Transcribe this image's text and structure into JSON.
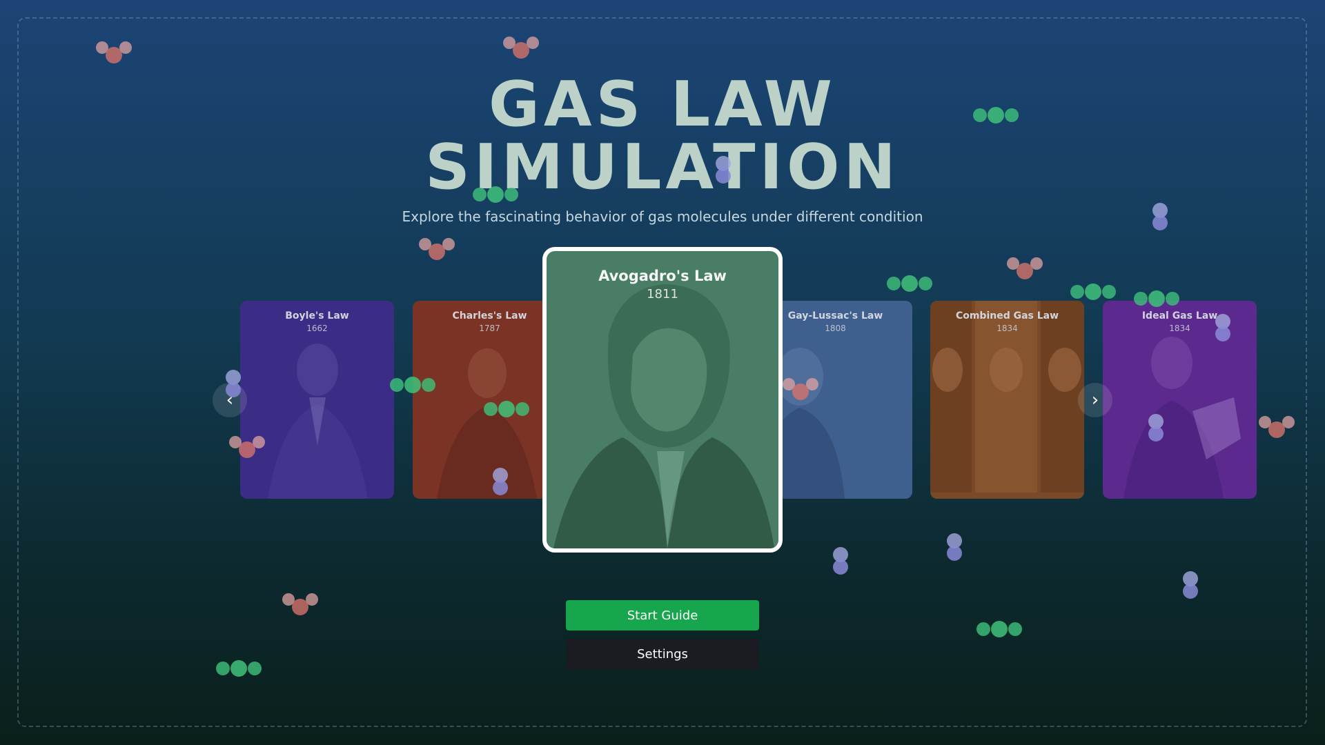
{
  "title": {
    "line1": "GAS LAW",
    "line2": "SIMULATION"
  },
  "subtitle": "Explore the fascinating behavior of gas molecules under different condition",
  "cards": [
    {
      "name": "Boyle's Law",
      "year": "1662",
      "color": "#3b2d85"
    },
    {
      "name": "Charles's Law",
      "year": "1787",
      "color": "#7a3324"
    },
    {
      "name": "Avogadro's Law",
      "year": "1811",
      "color": "#3f7a60"
    },
    {
      "name": "Gay-Lussac's Law",
      "year": "1808",
      "color": "#3f5f8e"
    },
    {
      "name": "Combined Gas Law",
      "year": "1834",
      "color": "#7a4a28"
    },
    {
      "name": "Ideal Gas Law",
      "year": "1834",
      "color": "#5c2a8e"
    }
  ],
  "active_card_index": 2,
  "nav": {
    "prev_icon": "chevron-left-icon",
    "next_icon": "chevron-right-icon"
  },
  "buttons": {
    "start": "Start Guide",
    "settings": "Settings"
  },
  "colors": {
    "start_button": "#17a64d",
    "molecule_red": "#d5736a",
    "molecule_green": "#3fc27a",
    "molecule_purple": "#8a8ad6"
  }
}
